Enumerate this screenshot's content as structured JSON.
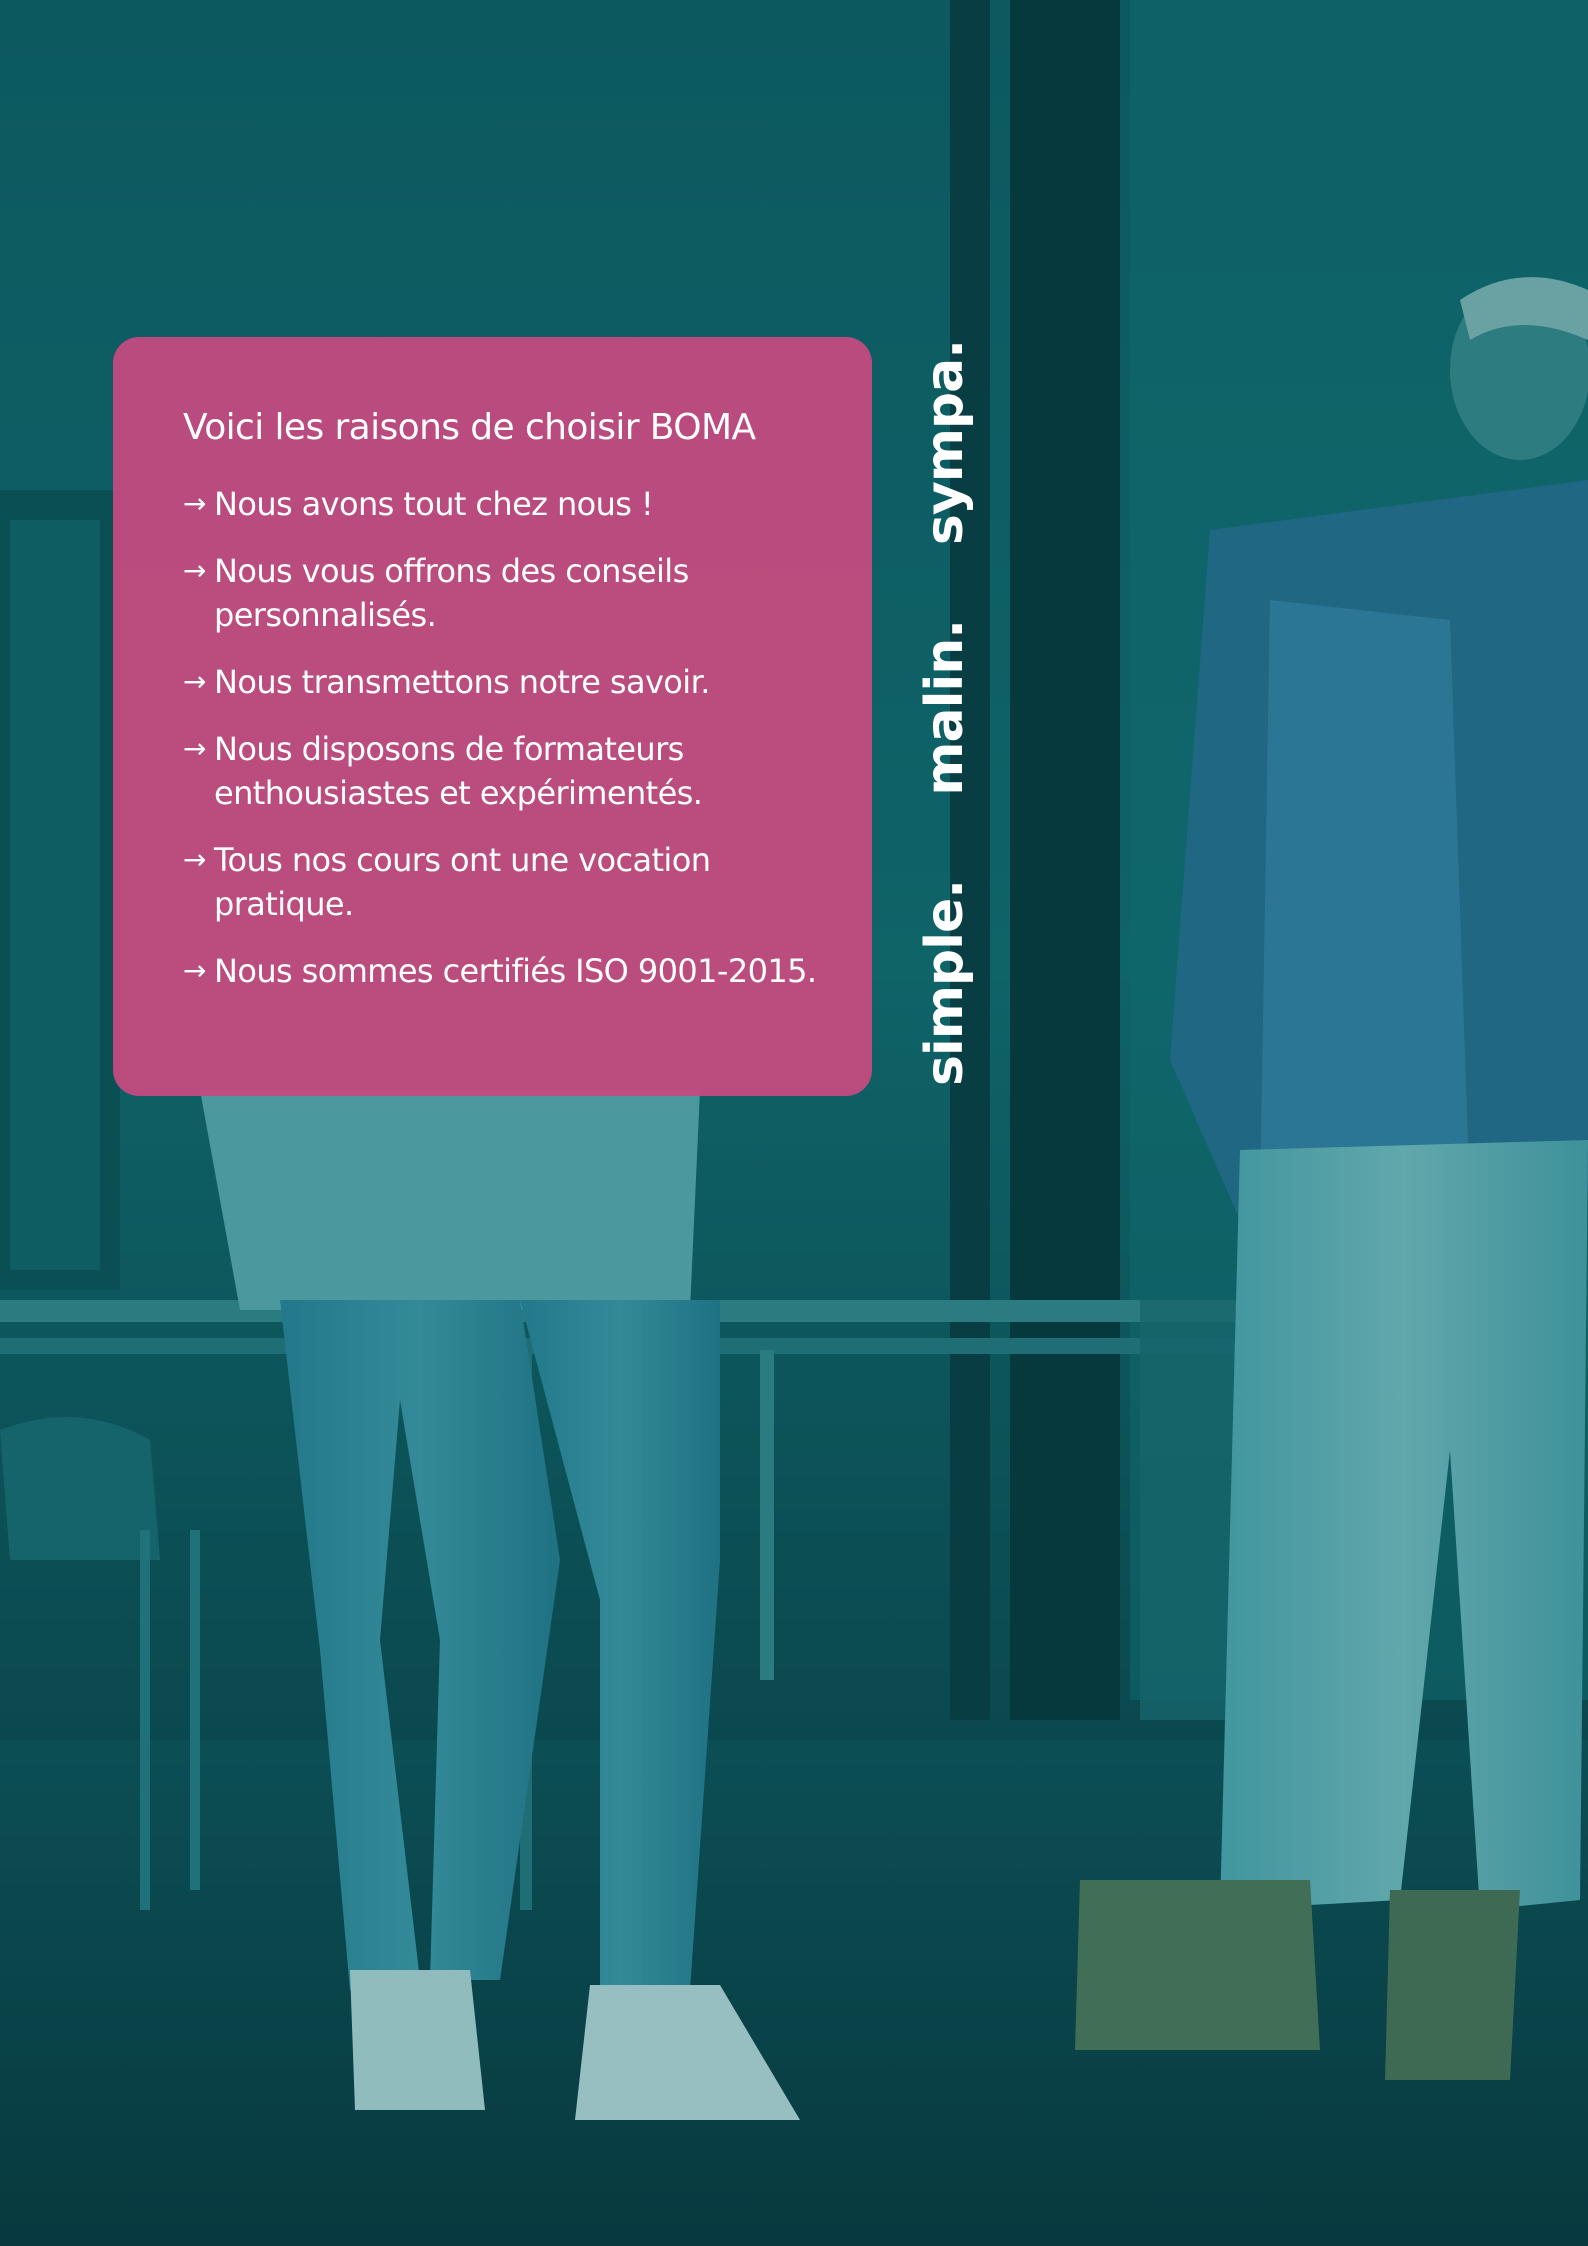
{
  "card": {
    "title": "Voici les raisons de choisir BOMA",
    "arrow_glyph": "→",
    "reasons": [
      {
        "lines": [
          "Nous avons tout chez nous !"
        ]
      },
      {
        "lines": [
          "Nous vous offrons des conseils",
          "personnalisés."
        ]
      },
      {
        "lines": [
          "Nous transmettons notre savoir."
        ]
      },
      {
        "lines": [
          "Nous disposons de formateurs",
          "enthousiastes et expérimentés."
        ]
      },
      {
        "lines": [
          "Tous nos cours ont une vocation",
          "pratique."
        ]
      },
      {
        "lines": [
          "Nous sommes certifiés ISO 9001-2015."
        ]
      }
    ]
  },
  "slogan": {
    "words": [
      "simple.",
      "malin.",
      "sympa."
    ]
  },
  "colors": {
    "card_background": "#c64a80",
    "overlay_teal": "#0b5a60",
    "text": "#ffffff"
  }
}
